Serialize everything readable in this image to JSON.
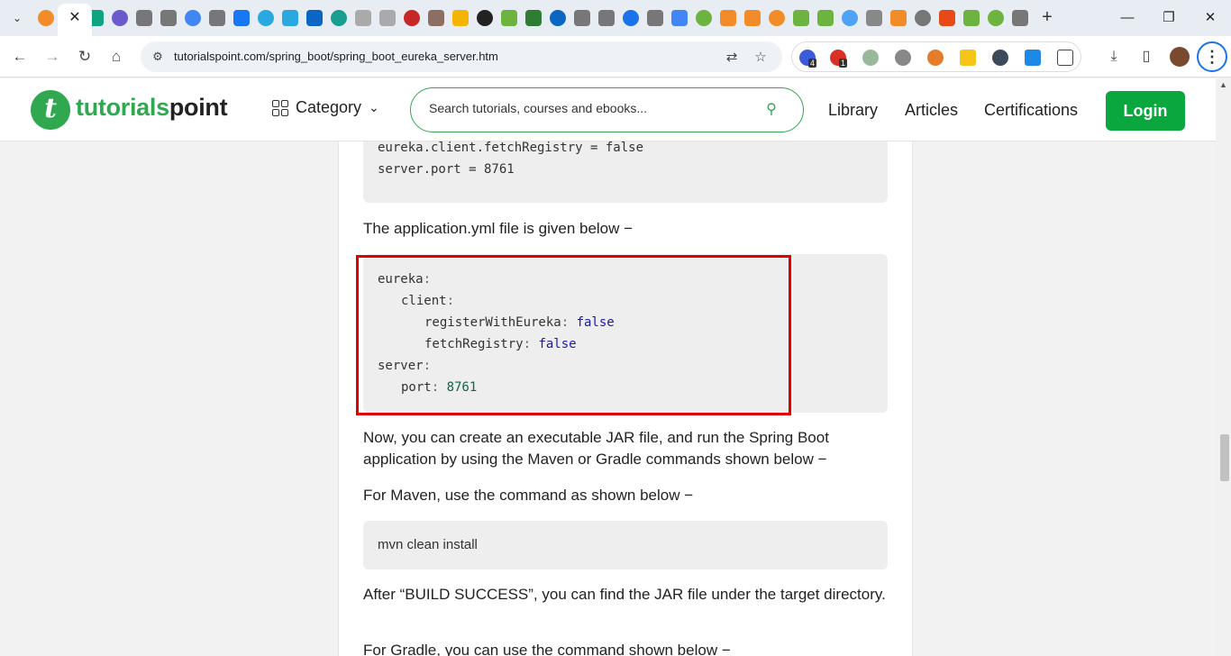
{
  "browser": {
    "url": "tutorialspoint.com/spring_boot/spring_boot_eureka_server.htm",
    "ext_badges": [
      "4",
      "1"
    ],
    "colors": {
      "tabstrip": "#e8ecf3",
      "accent": "#1a73e8"
    }
  },
  "site": {
    "logo_part1": "tutorials",
    "logo_part2": "point",
    "category_label": "Category",
    "search_placeholder": "Search tutorials, courses and ebooks...",
    "nav": [
      "Library",
      "Articles",
      "Certifications"
    ],
    "login_label": "Login",
    "brand_color": "#2fa84f"
  },
  "content": {
    "properties_code": [
      "eureka.client.fetchRegistry = false",
      "server.port = 8761"
    ],
    "yml_intro": "The application.yml file is given below −",
    "yml_code": {
      "l1": "eureka",
      "l2": "client",
      "l3_key": "registerWithEureka",
      "l3_val": "false",
      "l4_key": "fetchRegistry",
      "l4_val": "false",
      "l5": "server",
      "l6_key": "port",
      "l6_val": "8761"
    },
    "para_build": "Now, you can create an executable JAR file, and run the Spring Boot application by using the Maven or Gradle commands shown below −",
    "para_maven": "For Maven, use the command as shown below −",
    "maven_cmd": "mvn clean install",
    "para_success": "After “BUILD SUCCESS”, you can find the JAR file under the target directory.",
    "para_gradle": "For Gradle, you can use the command shown below −"
  }
}
